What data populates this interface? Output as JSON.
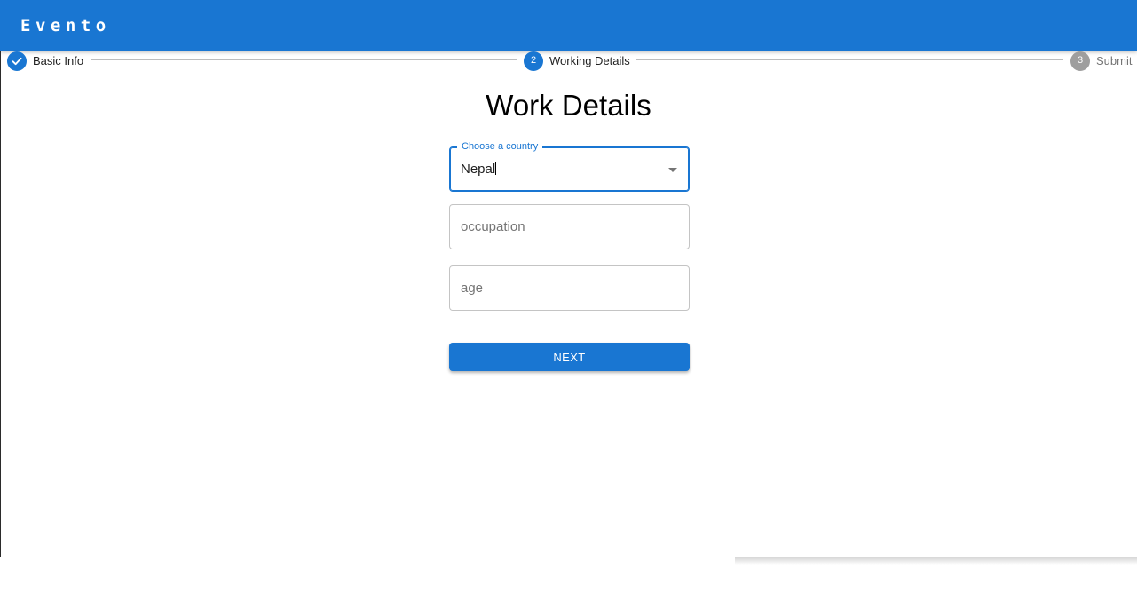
{
  "app": {
    "title": "Evento"
  },
  "stepper": {
    "steps": [
      {
        "number": "1",
        "label": "Basic Info",
        "status": "done",
        "icon": "check-icon"
      },
      {
        "number": "2",
        "label": "Working Details",
        "status": "active"
      },
      {
        "number": "3",
        "label": "Submit",
        "status": "pending"
      }
    ]
  },
  "form": {
    "title": "Work Details",
    "country": {
      "label": "Choose a country",
      "value": "Nepal",
      "icon": "chevron-down-icon"
    },
    "occupation": {
      "placeholder": "occupation",
      "value": ""
    },
    "age": {
      "placeholder": "age",
      "value": ""
    },
    "next_label": "NEXT"
  },
  "colors": {
    "primary": "#1976d2",
    "pending_step": "#9e9e9e",
    "field_border": "#c4c4c4",
    "placeholder_text": "#757575"
  }
}
